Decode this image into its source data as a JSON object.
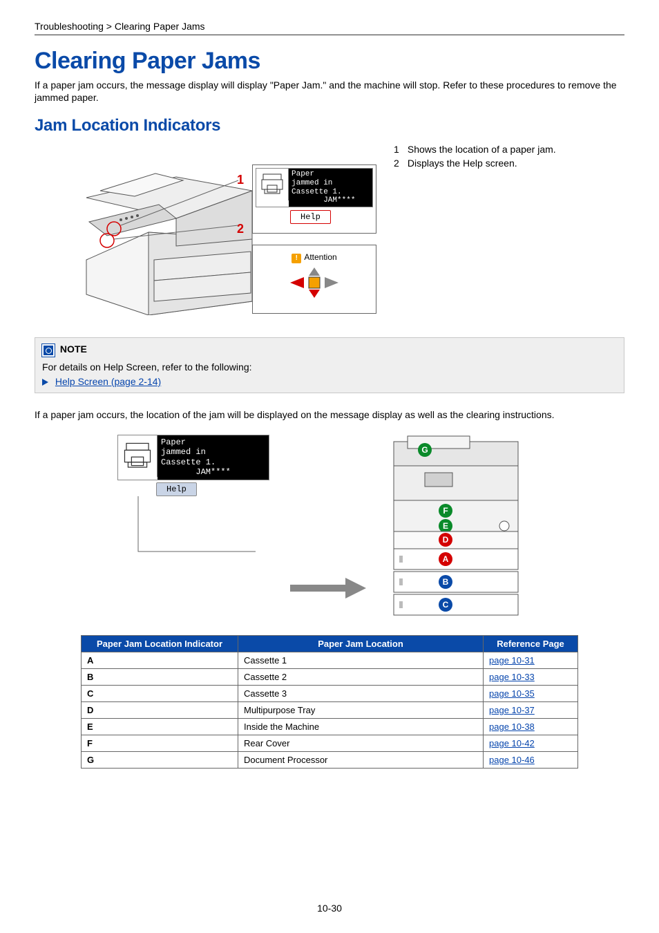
{
  "breadcrumb": "Troubleshooting > Clearing Paper Jams",
  "h1": "Clearing Paper Jams",
  "intro": "If a paper jam occurs, the message display will display \"Paper Jam.\" and the machine will stop. Refer to these procedures to remove the jammed paper.",
  "h2": "Jam Location Indicators",
  "callouts": {
    "num1": "1",
    "num2": "2",
    "legend1_n": "1",
    "legend1_t": "Shows the location of a paper jam.",
    "legend2_n": "2",
    "legend2_t": "Displays the Help screen."
  },
  "popup_msg": {
    "line": "Paper\njammed in\nCassette 1.\n       JAM****",
    "help": "Help"
  },
  "popup_att": {
    "label": "Attention"
  },
  "note": {
    "title": "NOTE",
    "body": "For details on Help Screen, refer to the following:",
    "link": "Help Screen (page 2-14)"
  },
  "para2": "If a paper jam occurs, the location of the jam will be displayed on the message display as well as the clearing instructions.",
  "screen2": {
    "line": "Paper\njammed in\nCassette 1.\n       JAM****",
    "help": "Help"
  },
  "badges": {
    "A": "A",
    "B": "B",
    "C": "C",
    "D": "D",
    "E": "E",
    "F": "F",
    "G": "G"
  },
  "table": {
    "h_ind": "Paper Jam Location Indicator",
    "h_loc": "Paper Jam Location",
    "h_ref": "Reference Page",
    "rows": [
      {
        "ind": "A",
        "loc": "Cassette 1",
        "ref": "page 10-31"
      },
      {
        "ind": "B",
        "loc": "Cassette 2",
        "ref": "page 10-33"
      },
      {
        "ind": "C",
        "loc": "Cassette 3",
        "ref": "page 10-35"
      },
      {
        "ind": "D",
        "loc": "Multipurpose Tray",
        "ref": "page 10-37"
      },
      {
        "ind": "E",
        "loc": "Inside the Machine",
        "ref": "page 10-38"
      },
      {
        "ind": "F",
        "loc": "Rear Cover",
        "ref": "page 10-42"
      },
      {
        "ind": "G",
        "loc": "Document Processor",
        "ref": "page 10-46"
      }
    ]
  },
  "pagenum": "10-30"
}
